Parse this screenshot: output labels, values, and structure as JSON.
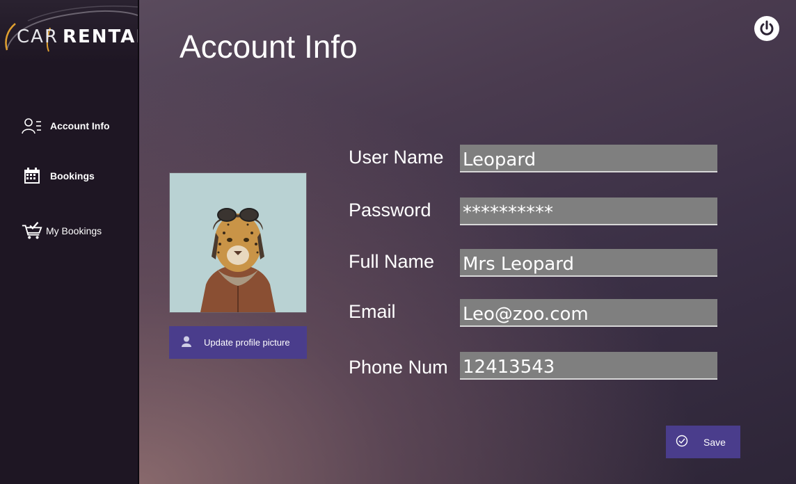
{
  "brand": {
    "car": "CAR",
    "rental": "RENTAL"
  },
  "sidebar": {
    "items": [
      {
        "label": "Account Info",
        "icon": "user-list-icon"
      },
      {
        "label": "Bookings",
        "icon": "calendar-icon"
      },
      {
        "label": "My Bookings",
        "icon": "cart-check-icon"
      }
    ]
  },
  "page": {
    "title": "Account Info"
  },
  "profile": {
    "update_label": "Update profile picture",
    "avatar_icon": "leopard-portrait"
  },
  "form": {
    "username_label": "User Name",
    "username_value": "Leopard",
    "password_label": "Password",
    "password_value": "**********",
    "fullname_label": "Full Name",
    "fullname_value": "Mrs Leopard",
    "email_label": "Email",
    "email_value": "Leo@zoo.com",
    "phone_label": "Phone Num",
    "phone_value": "12413543"
  },
  "actions": {
    "save_label": "Save"
  },
  "colors": {
    "accent": "#4a3d8c",
    "field_bg": "#7f7f7f",
    "sidebar_bg": "#1e1623"
  }
}
